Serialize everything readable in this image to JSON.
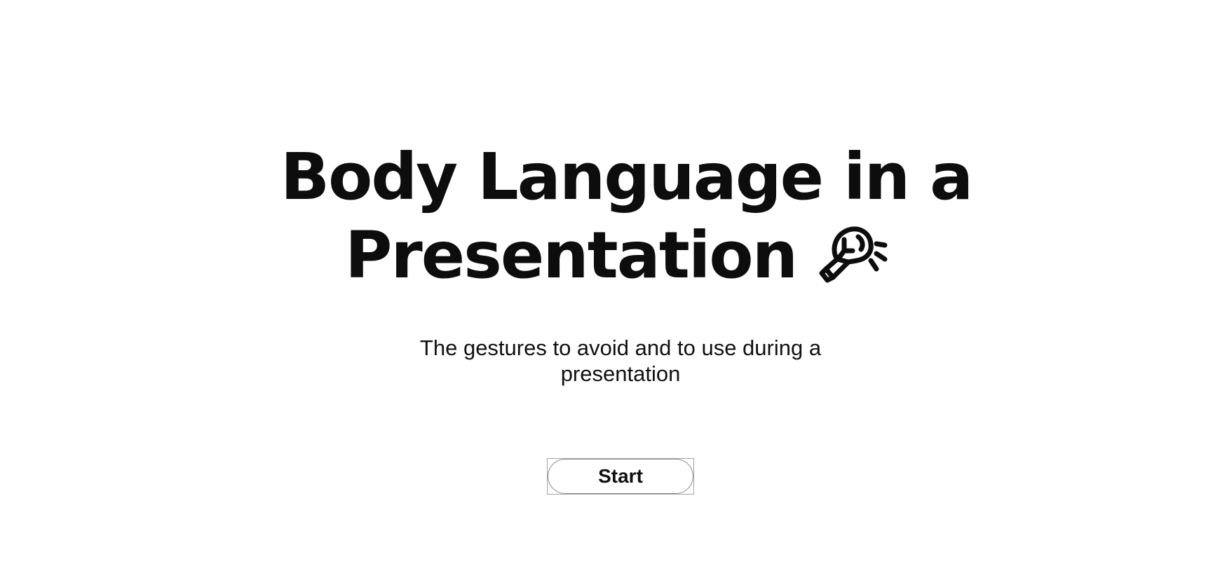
{
  "slide": {
    "title_line1": "Body Language in a",
    "title_line2": "Presentation",
    "title_icon": "lightbulb-idea-icon",
    "subtitle": "The gestures to avoid and to use during a presentation",
    "start_label": "Start"
  },
  "colors": {
    "background": "#ffffff",
    "text": "#0d0d0d",
    "button_border": "#8a8a8a"
  }
}
